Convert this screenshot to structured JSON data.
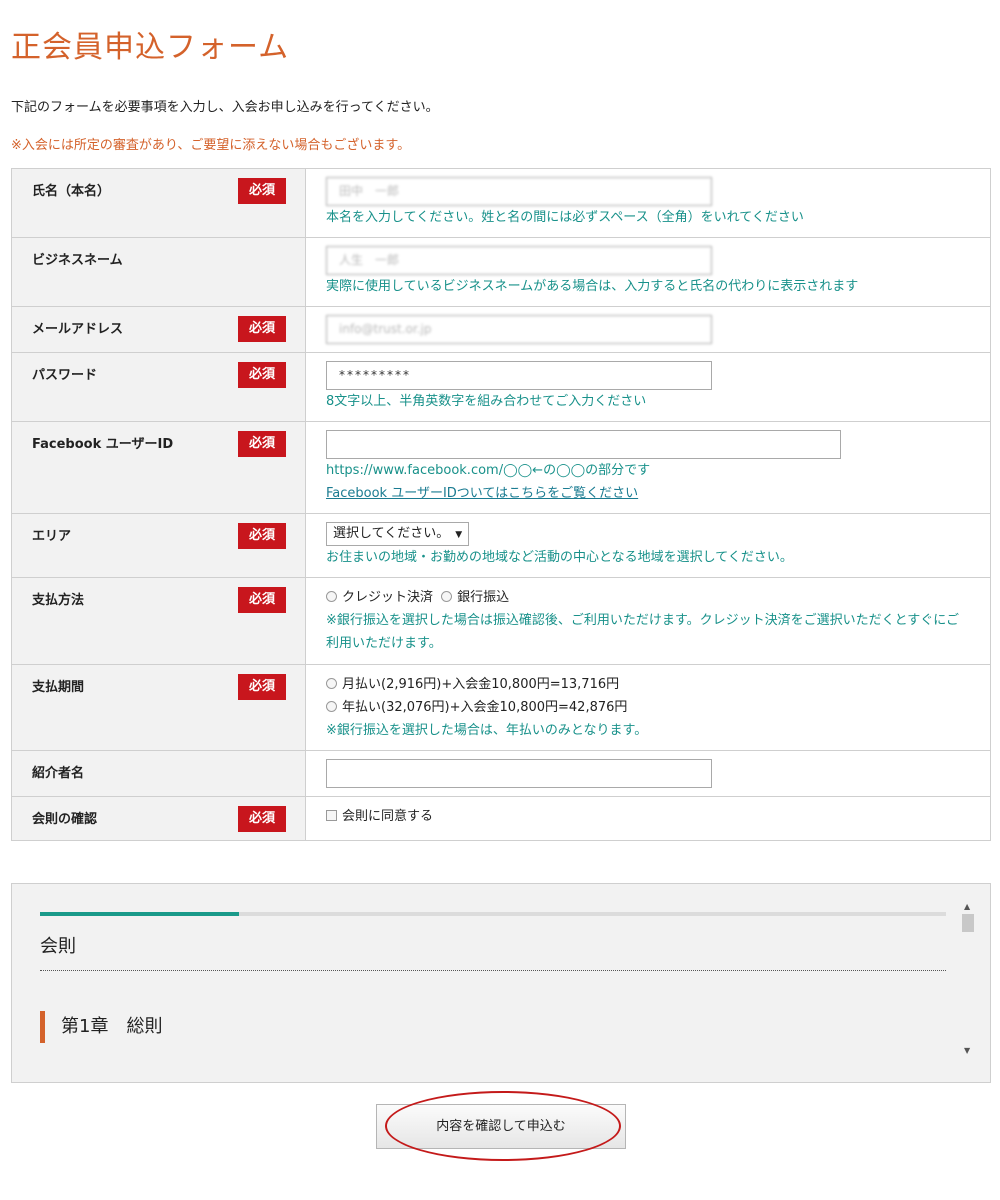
{
  "page": {
    "title": "正会員申込フォーム",
    "intro": "下記のフォームを必要事項を入力し、入会お申し込みを行ってください。",
    "notice": "※入会には所定の審査があり、ご要望に添えない場合もございます。"
  },
  "colors": {
    "accent": "#d4622b",
    "required": "#c8161d",
    "hint": "#18918a",
    "progress": "#1a9a8a"
  },
  "required_label": "必須",
  "fields": {
    "name": {
      "label": "氏名（本名）",
      "value": "田中　一郎",
      "hint": "本名を入力してください。姓と名の間には必ずスペース（全角）をいれてください"
    },
    "business_name": {
      "label": "ビジネスネーム",
      "value": "人生　一郎",
      "hint": "実際に使用しているビジネスネームがある場合は、入力すると氏名の代わりに表示されます"
    },
    "email": {
      "label": "メールアドレス",
      "value": "info@trust.or.jp"
    },
    "password": {
      "label": "パスワード",
      "value": "*********",
      "hint": "8文字以上、半角英数字を組み合わせてご入力ください"
    },
    "facebook": {
      "label": "Facebook ユーザーID",
      "value": "",
      "hint": "https://www.facebook.com/◯◯←の◯◯の部分です",
      "link": "Facebook ユーザーIDついてはこちらをご覧ください"
    },
    "area": {
      "label": "エリア",
      "selected": "選択してください。",
      "hint": "お住まいの地域・お勤めの地域など活動の中心となる地域を選択してください。"
    },
    "payment_method": {
      "label": "支払方法",
      "options": [
        "クレジット決済",
        "銀行振込"
      ],
      "hint": "※銀行振込を選択した場合は振込確認後、ご利用いただけます。クレジット決済をご選択いただくとすぐにご利用いただけます。"
    },
    "payment_period": {
      "label": "支払期間",
      "options": [
        "月払い(2,916円)+入会金10,800円=13,716円",
        "年払い(32,076円)+入会金10,800円=42,876円"
      ],
      "hint": "※銀行振込を選択した場合は、年払いのみとなります。"
    },
    "referrer": {
      "label": "紹介者名",
      "value": ""
    },
    "rules_confirm": {
      "label": "会則の確認",
      "checkbox": "会則に同意する"
    }
  },
  "rules": {
    "title": "会則",
    "chapter": "第1章　総則",
    "progress_fraction": 0.22
  },
  "submit_label": "内容を確認して申込む"
}
